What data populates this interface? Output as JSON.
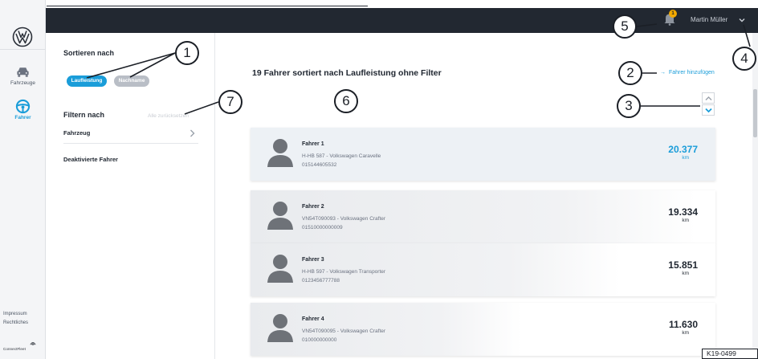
{
  "sidebar": {
    "items": [
      {
        "label": "Fahrzeuge",
        "icon": "car-icon",
        "active": false
      },
      {
        "label": "Fahrer",
        "icon": "steering-wheel-icon",
        "active": true
      }
    ],
    "footer": {
      "impressum": "Impressum",
      "rechtliches": "Rechtliches",
      "brand": "ConnectFleet"
    }
  },
  "header": {
    "user_name": "Martin Müller",
    "notification_count": "1"
  },
  "filter_panel": {
    "sort_title": "Sortieren nach",
    "sort_options": [
      "Laufleistung",
      "Nachname"
    ],
    "filter_title": "Filtern nach",
    "reset_label": "Alle zurücksetzen",
    "rows": [
      "Fahrzeug",
      "Deaktivierte Fahrer"
    ]
  },
  "main": {
    "heading": "19 Fahrer sortiert nach Laufleistung ohne Filter",
    "add_driver_label": "Fahrer hinzufügen",
    "drivers": [
      {
        "name": "Fahrer 1",
        "vehicle": "H-HB 587 - Volkswagen Caravelle",
        "phone": "015144605532",
        "mileage": "20.377",
        "unit": "km",
        "highlighted": true
      },
      {
        "name": "Fahrer 2",
        "vehicle": "VN54T090093 - Volkswagen Crafter",
        "phone": "01510000000009",
        "mileage": "19.334",
        "unit": "km",
        "highlighted": false
      },
      {
        "name": "Fahrer 3",
        "vehicle": "H-HB 597 - Volkswagen Transporter",
        "phone": "0123456777788",
        "mileage": "15.851",
        "unit": "km",
        "highlighted": false
      },
      {
        "name": "Fahrer 4",
        "vehicle": "VN54T090095 - Volkswagen Crafter",
        "phone": "010000000000",
        "mileage": "11.630",
        "unit": "km",
        "highlighted": false
      }
    ]
  },
  "callouts": [
    "1",
    "2",
    "3",
    "4",
    "5",
    "6",
    "7"
  ],
  "reference_code": "K19-0499",
  "colors": {
    "accent": "#1a9dd9",
    "header_bg": "#222831",
    "badge": "#f2a900"
  }
}
